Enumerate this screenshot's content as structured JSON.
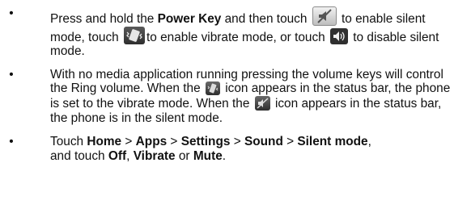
{
  "bullet": "•",
  "item1": {
    "t1": "Press and hold the ",
    "power_key": "Power Key",
    "t2": " and then touch ",
    "t3": " to enable silent mode, touch ",
    "t4": "to enable vibrate mode, or touch ",
    "t5": " to disable silent mode."
  },
  "item2": {
    "t1": "With no media application running pressing the volume keys will control the Ring volume. When the ",
    "t2": " icon appears in the status bar, the phone is set to the vibrate mode. When the ",
    "t3": " icon appears in the status bar, the phone is in the silent mode."
  },
  "item3": {
    "t1": "Touch ",
    "home": "Home",
    "sep1": " > ",
    "apps": "Apps",
    "sep2": " > ",
    "settings": "Settings",
    "sep3": " > ",
    "sound": "Sound",
    "sep4": " > ",
    "silent_mode": "Silent mode",
    "t2": ",",
    "t3": "and touch ",
    "off": "Off",
    "comma": ", ",
    "vibrate": "Vibrate",
    "or": " or ",
    "mute": "Mute",
    "period": "."
  },
  "icons": {
    "silent": "speaker-muted-icon",
    "vibrate": "vibrate-phone-icon",
    "sound_on": "speaker-on-icon"
  },
  "colors": {
    "text": "#111111",
    "icon_dark": "#3a3a3a",
    "icon_light": "#d9d9d9"
  }
}
